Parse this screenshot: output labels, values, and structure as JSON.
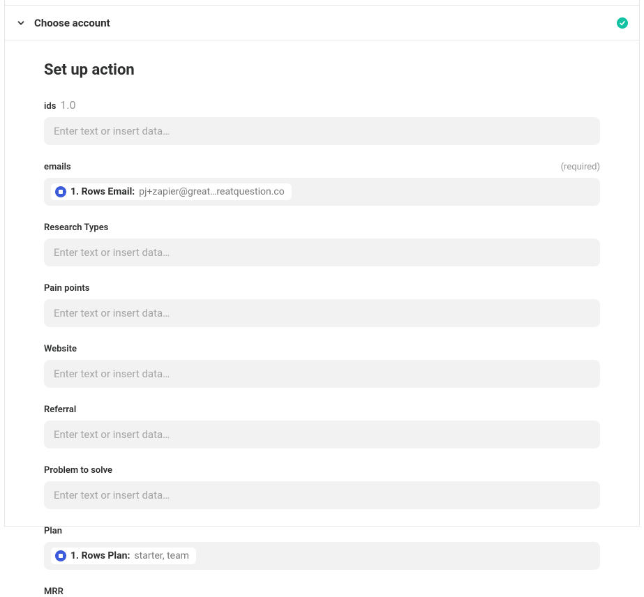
{
  "account": {
    "title": "Choose account",
    "completed": true
  },
  "heading": "Set up action",
  "fields": {
    "ids": {
      "label": "ids",
      "sublabel": "1.0",
      "placeholder": "Enter text or insert data…"
    },
    "emails": {
      "label": "emails",
      "required_text": "(required)",
      "pill_label": "1. Rows Email:",
      "pill_value": "pj+zapier@great…reatquestion.co"
    },
    "research_types": {
      "label": "Research Types",
      "placeholder": "Enter text or insert data…"
    },
    "pain_points": {
      "label": "Pain points",
      "placeholder": "Enter text or insert data…"
    },
    "website": {
      "label": "Website",
      "placeholder": "Enter text or insert data…"
    },
    "referral": {
      "label": "Referral",
      "placeholder": "Enter text or insert data…"
    },
    "problem": {
      "label": "Problem to solve",
      "placeholder": "Enter text or insert data…"
    },
    "plan": {
      "label": "Plan",
      "pill_label": "1. Rows Plan:",
      "pill_value": "starter, team"
    },
    "mrr": {
      "label": "MRR"
    }
  }
}
